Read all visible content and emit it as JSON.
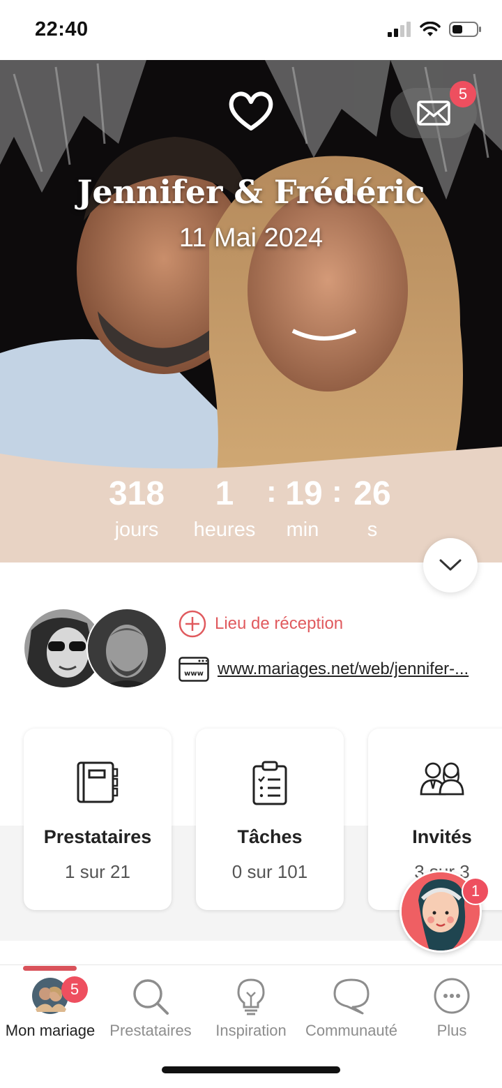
{
  "status_bar": {
    "time": "22:40"
  },
  "header": {
    "couple_names": "Jennifer & Frédéric",
    "wedding_date": "11 Mai 2024",
    "mail_badge": "5"
  },
  "countdown": {
    "days": "318",
    "days_label": "jours",
    "hours": "1",
    "hours_label": "heures",
    "minutes": "19",
    "minutes_label": "min",
    "seconds": "26",
    "seconds_label": "s",
    "separator": ":"
  },
  "profile": {
    "venue_label": "Lieu de réception",
    "website_url": "www.mariages.net/web/jennifer-..."
  },
  "cards": [
    {
      "title": "Prestataires",
      "subtitle": "1 sur 21",
      "icon": "notebook-icon"
    },
    {
      "title": "Tâches",
      "subtitle": "0 sur 101",
      "icon": "clipboard-checklist-icon"
    },
    {
      "title": "Invités",
      "subtitle": "3 sur 3",
      "icon": "guests-icon"
    }
  ],
  "assistant": {
    "badge": "1"
  },
  "tabbar": {
    "items": [
      {
        "label": "Mon mariage",
        "icon": "couple-avatar-icon",
        "active": true,
        "badge": "5"
      },
      {
        "label": "Prestataires",
        "icon": "search-icon"
      },
      {
        "label": "Inspiration",
        "icon": "lightbulb-icon"
      },
      {
        "label": "Communauté",
        "icon": "chat-bubble-icon"
      },
      {
        "label": "Plus",
        "icon": "more-icon"
      }
    ]
  },
  "colors": {
    "accent": "#e05a5e",
    "countdown_bg": "#e8d3c4",
    "badge": "#ee4f5f"
  }
}
